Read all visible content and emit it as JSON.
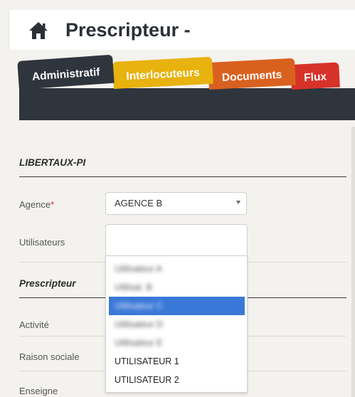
{
  "header": {
    "title": "Prescripteur -",
    "icon": "home-icon"
  },
  "tabs": [
    {
      "label": "Administratif",
      "color": "#2f353d",
      "active": true
    },
    {
      "label": "Interlocuteurs",
      "color": "#e8b20f"
    },
    {
      "label": "Documents",
      "color": "#d9611f"
    },
    {
      "label": "Flux",
      "color": "#d7322a"
    }
  ],
  "section1": {
    "title": "LIBERTAUX-PI"
  },
  "agence": {
    "label": "Agence",
    "required_mark": "*",
    "value": "AGENCE B"
  },
  "utilisateurs": {
    "label": "Utilisateurs",
    "options": [
      {
        "label": "Utilisateur A",
        "blurred": true
      },
      {
        "label": "Utilisat. B",
        "blurred": true
      },
      {
        "label": "Utilisateur C",
        "blurred": true,
        "highlighted": true
      },
      {
        "label": "Utilisateur D",
        "blurred": true
      },
      {
        "label": "Utilisateur E",
        "blurred": true
      },
      {
        "label": "UTILISATEUR 1"
      },
      {
        "label": "UTILISATEUR 2"
      }
    ]
  },
  "section2": {
    "title": "Prescripteur"
  },
  "fields": {
    "activite": "Activité",
    "raison_sociale": "Raison sociale",
    "enseigne": "Enseigne"
  },
  "colors": {
    "tabbar": "#2f353d",
    "highlight": "#3a78d8"
  }
}
